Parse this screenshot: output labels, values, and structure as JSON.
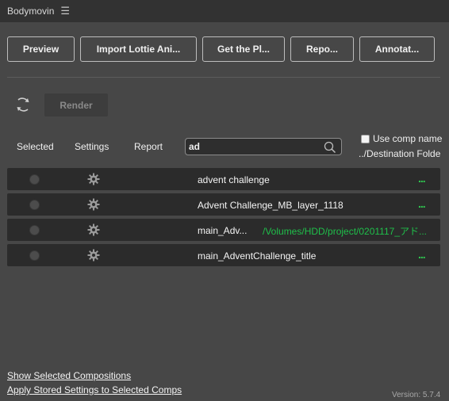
{
  "panel": {
    "title": "Bodymovin",
    "menu_icon": "hamburger-menu-icon"
  },
  "toolbar": {
    "preview": "Preview",
    "import": "Import Lottie Ani...",
    "get_plugin": "Get the Pl...",
    "report": "Repo...",
    "annotate": "Annotat..."
  },
  "render": {
    "label": "Render",
    "refresh_icon": "refresh-icon"
  },
  "header": {
    "selected": "Selected",
    "settings": "Settings",
    "report": "Report",
    "use_comp_name": "Use comp name",
    "destination": "../Destination Folde"
  },
  "search": {
    "value": "ad",
    "placeholder": ""
  },
  "comps": [
    {
      "name": "advent challenge",
      "destination": "",
      "dots": "..."
    },
    {
      "name": "Advent Challenge_MB_layer_1118",
      "destination": "",
      "dots": "..."
    },
    {
      "name": "main_Adv...",
      "destination": "/Volumes/HDD/project/0201117_アド...",
      "dots": ""
    },
    {
      "name": "main_AdventChallenge_title",
      "destination": "",
      "dots": "..."
    }
  ],
  "footer": {
    "show_selected": "Show Selected Compositions",
    "apply_settings": "Apply Stored Settings to Selected Comps",
    "version": "Version: 5.7.4"
  },
  "colors": {
    "background": "#474747",
    "row": "#2b2b2b",
    "accent_green": "#1fbf4a",
    "titlebar": "#323232"
  }
}
